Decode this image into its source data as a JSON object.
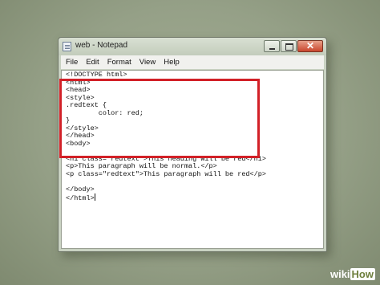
{
  "window": {
    "title": "web - Notepad",
    "close_glyph": "✕"
  },
  "menu": [
    "File",
    "Edit",
    "Format",
    "View",
    "Help"
  ],
  "code_lines": [
    "<!DOCTYPE html>",
    "<html>",
    "<head>",
    "<style>",
    ".redtext {",
    "        color: red;",
    "}",
    "</style>",
    "</head>",
    "<body>",
    "",
    "<h1 class=\"redtext\">This heading will be red</h1>",
    "<p>This paragraph will be normal.</p>",
    "<p class=\"redtext\">This paragraph will be red</p>",
    "",
    "</body>",
    "</html>"
  ],
  "highlight_color": "#d22027",
  "watermark": {
    "wiki": "wiki",
    "how": "How"
  }
}
